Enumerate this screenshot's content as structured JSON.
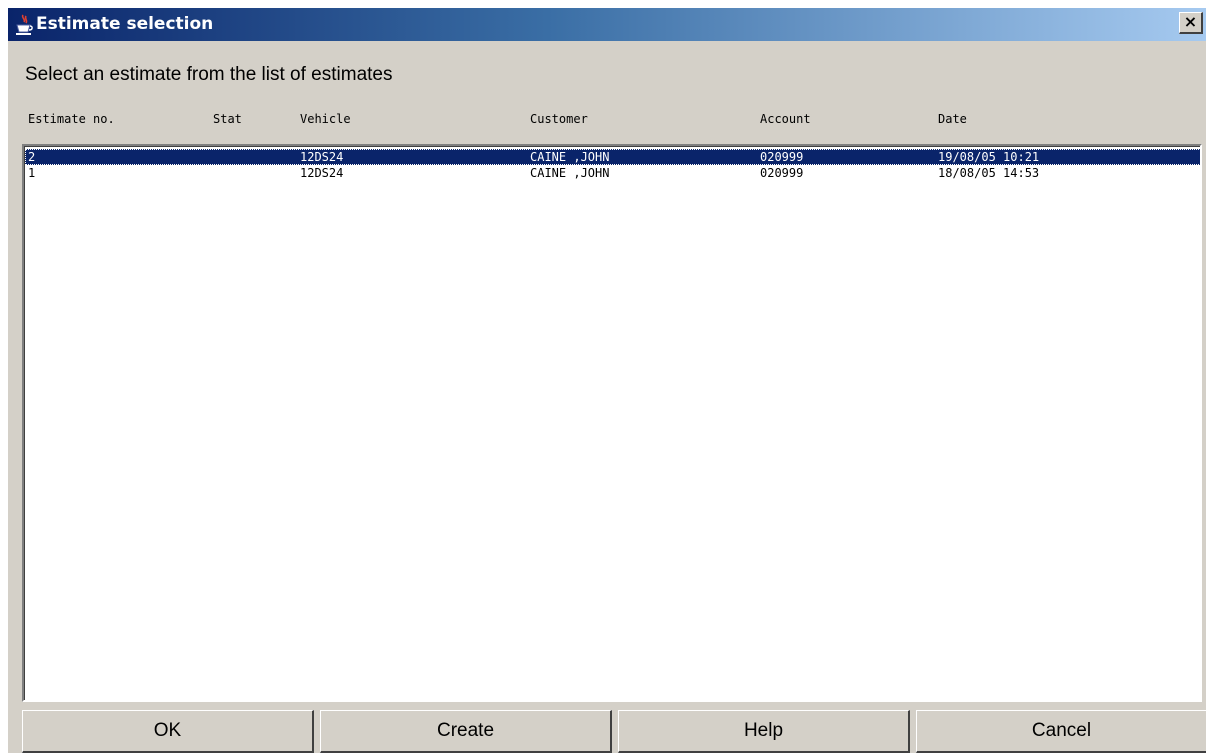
{
  "window": {
    "title": "Estimate selection",
    "close_glyph": "×",
    "icon": "java-cup-icon"
  },
  "prompt": "Select an estimate from the list of estimates",
  "columns": [
    {
      "key": "estimate_no",
      "label": "Estimate no."
    },
    {
      "key": "stat",
      "label": "Stat"
    },
    {
      "key": "vehicle",
      "label": "Vehicle"
    },
    {
      "key": "customer",
      "label": "Customer"
    },
    {
      "key": "account",
      "label": "Account"
    },
    {
      "key": "date",
      "label": "Date"
    }
  ],
  "rows": [
    {
      "estimate_no": "2",
      "stat": "",
      "vehicle": "12DS24",
      "customer": "CAINE ,JOHN",
      "account": "020999",
      "date": "19/08/05 10:21",
      "selected": true
    },
    {
      "estimate_no": "1",
      "stat": "",
      "vehicle": "12DS24",
      "customer": "CAINE ,JOHN",
      "account": "020999",
      "date": "18/08/05 14:53",
      "selected": false
    }
  ],
  "buttons": {
    "ok": "OK",
    "create": "Create",
    "help": "Help",
    "cancel": "Cancel"
  },
  "colors": {
    "selection": "#0a246a",
    "dialog_background": "#d4d0c8"
  }
}
